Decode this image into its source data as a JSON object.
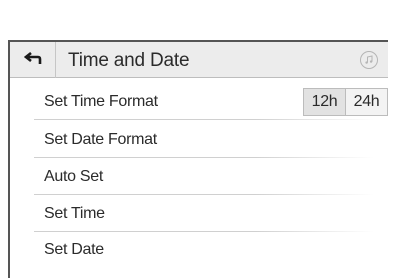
{
  "header": {
    "title": "Time and Date",
    "back_icon": "back-arrow-icon",
    "right_icon": "music-note-icon"
  },
  "rows": [
    {
      "label": "Set Time Format"
    },
    {
      "label": "Set Date Format"
    },
    {
      "label": "Auto Set"
    },
    {
      "label": "Set Time"
    },
    {
      "label": "Set Date"
    }
  ],
  "time_format": {
    "options": [
      "12h",
      "24h"
    ],
    "selected": "12h"
  }
}
